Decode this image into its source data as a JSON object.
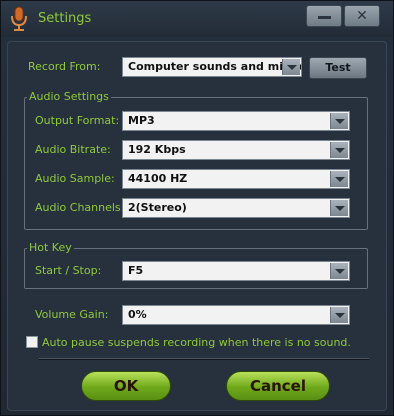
{
  "window": {
    "title": "Settings",
    "minimize_icon": "minimize-icon",
    "close_icon": "close-icon"
  },
  "record_from": {
    "label": "Record  From:",
    "value": "Computer sounds and microphone",
    "test_label": "Test"
  },
  "audio_settings": {
    "title": "Audio Settings",
    "output_format": {
      "label": "Output Format:",
      "value": "MP3"
    },
    "audio_bitrate": {
      "label": "Audio Bitrate:",
      "value": "192 Kbps"
    },
    "audio_sample": {
      "label": "Audio Sample:",
      "value": "44100 HZ"
    },
    "audio_channels": {
      "label": "Audio Channels:",
      "value": "2(Stereo)"
    }
  },
  "hot_key": {
    "title": "Hot Key",
    "start_stop": {
      "label": "Start / Stop:",
      "value": "F5"
    }
  },
  "volume_gain": {
    "label": "Volume Gain:",
    "value": "0%"
  },
  "auto_pause": {
    "label": "Auto pause suspends recording when there is no sound.",
    "checked": false
  },
  "buttons": {
    "ok": "OK",
    "cancel": "Cancel"
  },
  "colors": {
    "accent_text": "#8fc93a",
    "button_green": "#7fb524",
    "background": "#25303d"
  }
}
